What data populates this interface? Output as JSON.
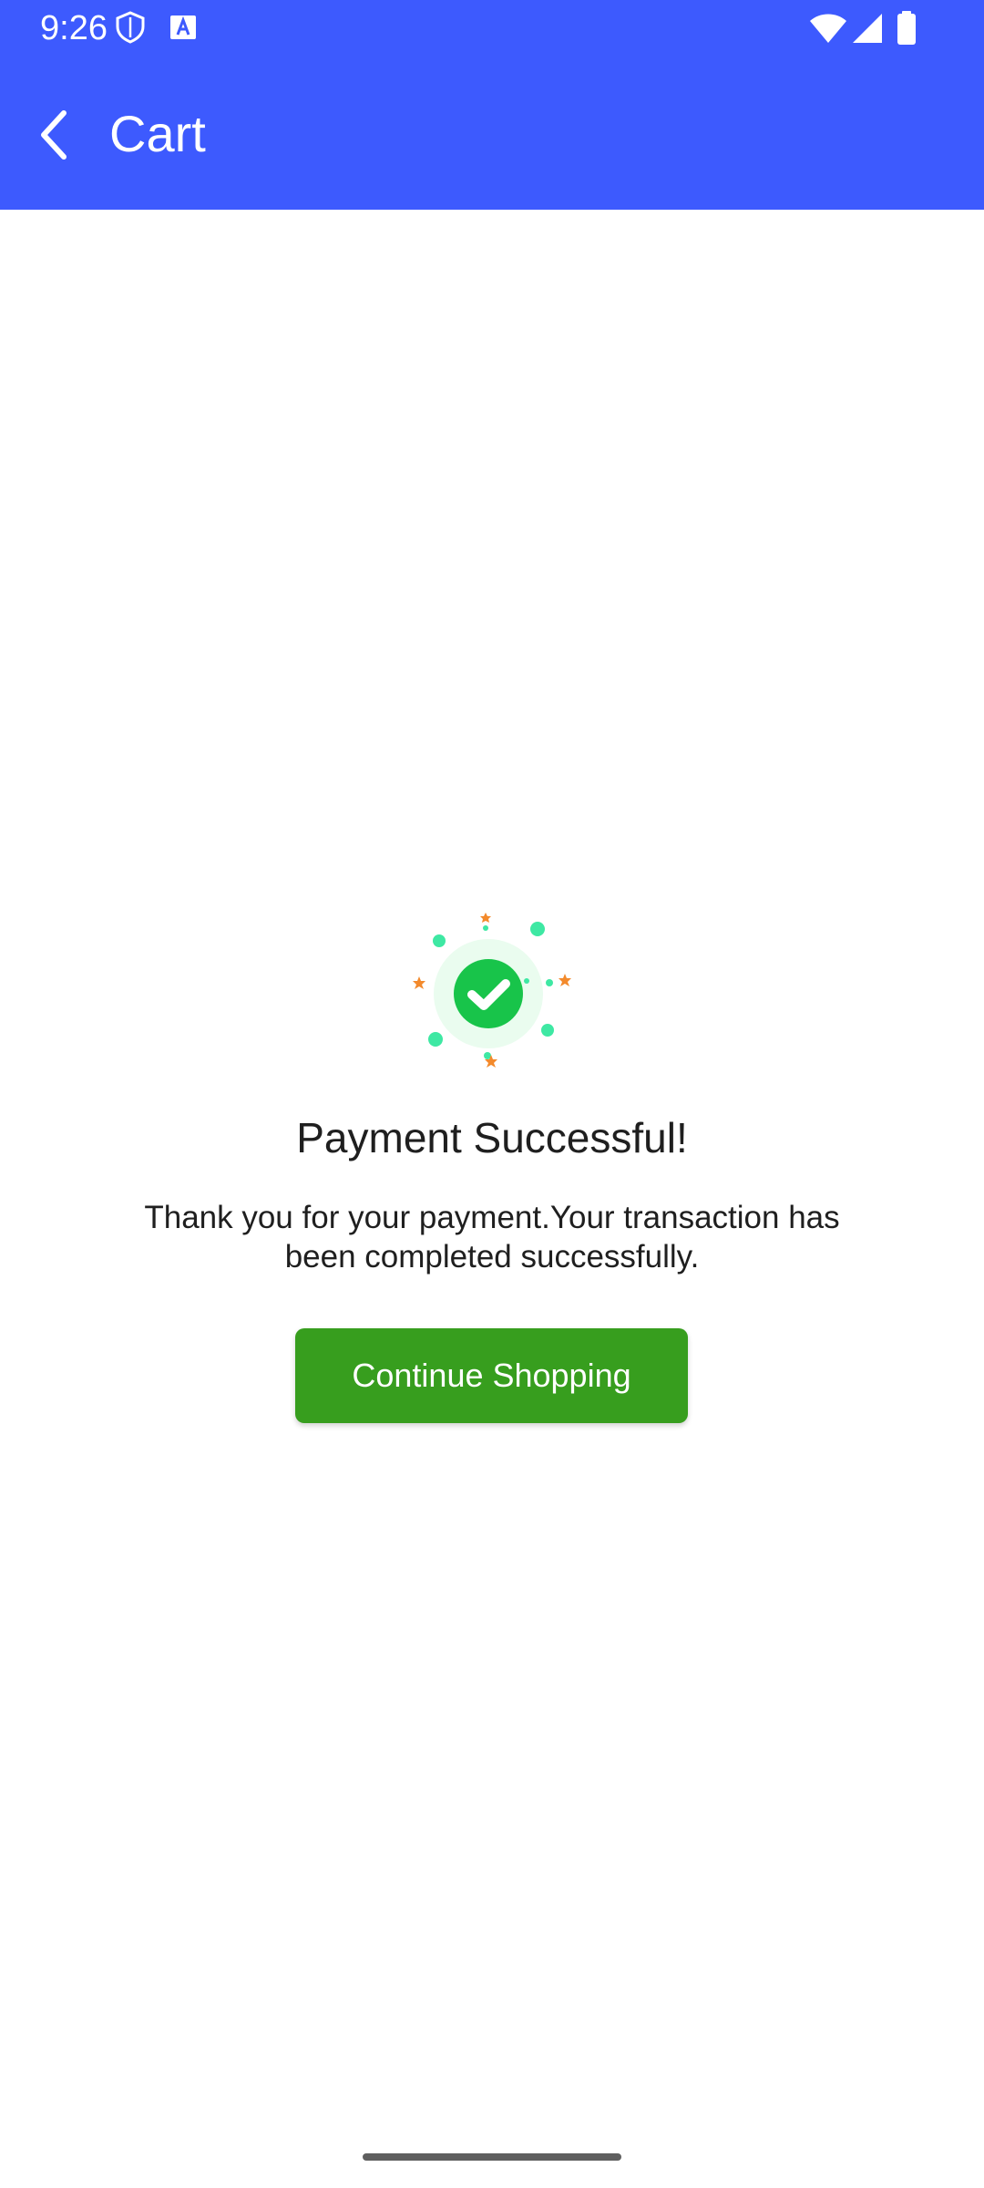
{
  "status_bar": {
    "time": "9:26",
    "icons": [
      "shield-icon",
      "text-a-icon",
      "wifi-icon",
      "signal-icon",
      "battery-icon"
    ]
  },
  "toolbar": {
    "title": "Cart",
    "back_icon": "chevron-left-icon"
  },
  "success": {
    "illustration": "check-circle-icon",
    "title": "Payment Successful!",
    "message": "Thank you for your payment.Your transaction has been completed successfully.",
    "button_label": "Continue Shopping"
  },
  "colors": {
    "appbar": "#3d5afe",
    "button": "#379e1e",
    "check": "#18c44a",
    "accent_dots": "#3ee8a3",
    "stars": "#f38a2c"
  }
}
